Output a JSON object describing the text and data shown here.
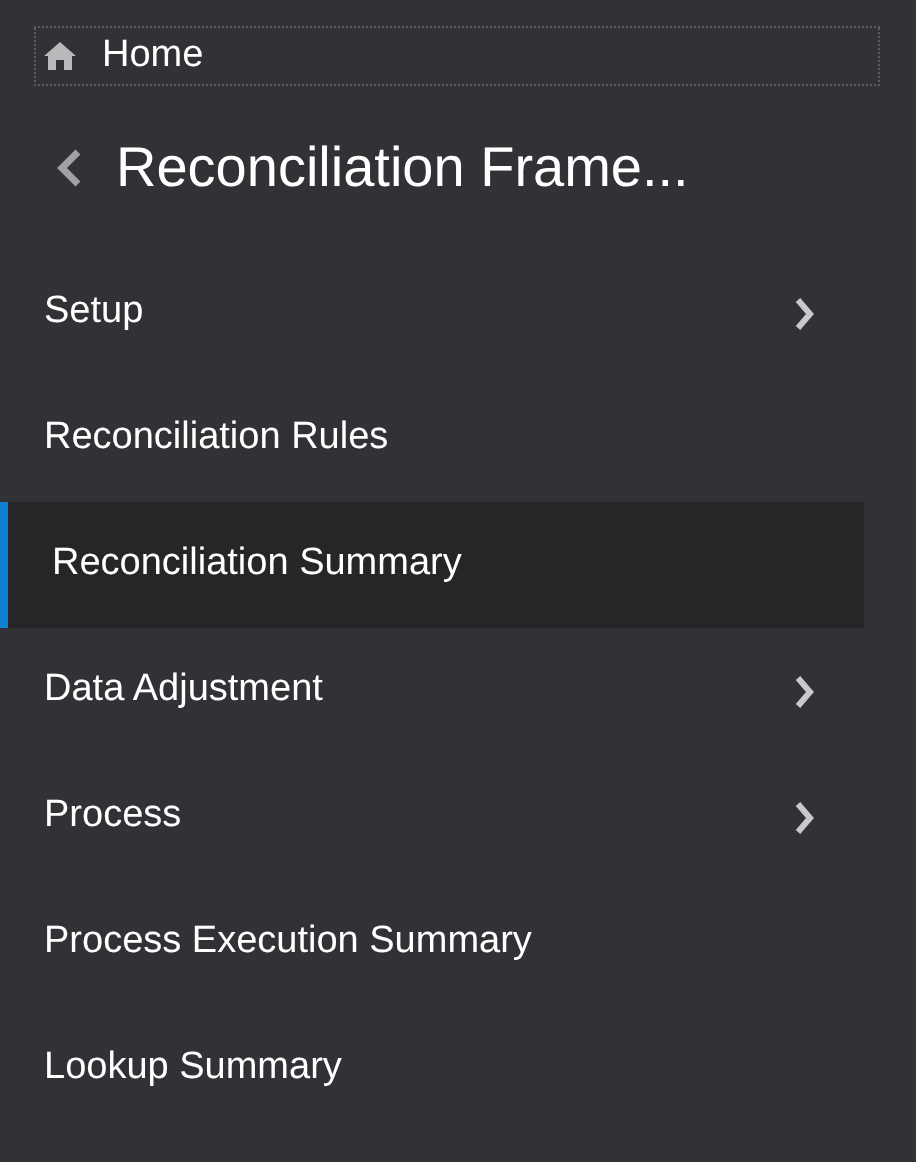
{
  "home_link": {
    "label": "Home"
  },
  "back_title": "Reconciliation Frame...",
  "menu_items": [
    {
      "label": "Setup",
      "expandable": true,
      "selected": false
    },
    {
      "label": "Reconciliation Rules",
      "expandable": false,
      "selected": false
    },
    {
      "label": "Reconciliation Summary",
      "expandable": false,
      "selected": true
    },
    {
      "label": "Data Adjustment",
      "expandable": true,
      "selected": false
    },
    {
      "label": "Process",
      "expandable": true,
      "selected": false
    },
    {
      "label": "Process Execution Summary",
      "expandable": false,
      "selected": false
    },
    {
      "label": "Lookup Summary",
      "expandable": false,
      "selected": false
    }
  ]
}
